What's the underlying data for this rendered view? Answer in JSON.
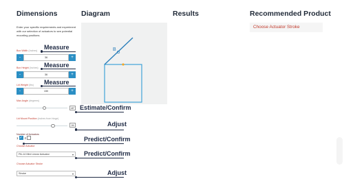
{
  "headers": {
    "dimensions": "Dimensions",
    "diagram": "Diagram",
    "results": "Results",
    "recommended": "Recommended Product"
  },
  "intro": "Enter your specific requirements and experiment with our selection of actuators to see potential mounting positions.",
  "fields": {
    "box_width": {
      "label": "Box Width",
      "unit": "(Inches)",
      "value": "36",
      "minus": "-",
      "plus": "+"
    },
    "box_height": {
      "label": "Box Height",
      "unit": "(Inches)",
      "value": "36",
      "minus": "-",
      "plus": "+"
    },
    "lid_weight": {
      "label": "Lid Weight",
      "unit": "(lbs)",
      "value": "150",
      "minus": "-",
      "plus": "+"
    },
    "max_angle": {
      "label": "Max Angle",
      "unit": "(degrees)",
      "value": "45°",
      "level": 0.55
    },
    "lid_mount": {
      "label": "Lid Mount Position",
      "unit": "(inches from hinge)",
      "value": "26",
      "level": 0.72
    }
  },
  "actuators": {
    "label": "Number of Actuators",
    "option1": "1",
    "option2": "2",
    "checked": "✓"
  },
  "choose_actuator": {
    "label": "Choose Actuator",
    "value": "PA-14 Mini Linear Actuator",
    "chevron": "▾"
  },
  "choose_stroke": {
    "label": "Choose Actuator Stroke",
    "value": "Stroke",
    "chevron": "▾"
  },
  "annotations": {
    "measure1": "Measure",
    "measure2": "Measure",
    "measure3": "Measure",
    "estimate": "Estimate/Confirm",
    "adjust1": "Adjust",
    "predict1": "Predict/Confirm",
    "predict2": "Predict/Confirm",
    "adjust2": "Adjust"
  },
  "diagram": {
    "point_label": "B",
    "box_color": "#3fa3d8",
    "lid_color": "#2b7fba",
    "hinge_color": "#f5a623"
  },
  "recommended": {
    "link": "Choose Actuator Stroke"
  },
  "colors": {
    "accent": "#2b8fc4",
    "label_red": "#c0392b",
    "annotation_navy": "#1f2a44"
  }
}
